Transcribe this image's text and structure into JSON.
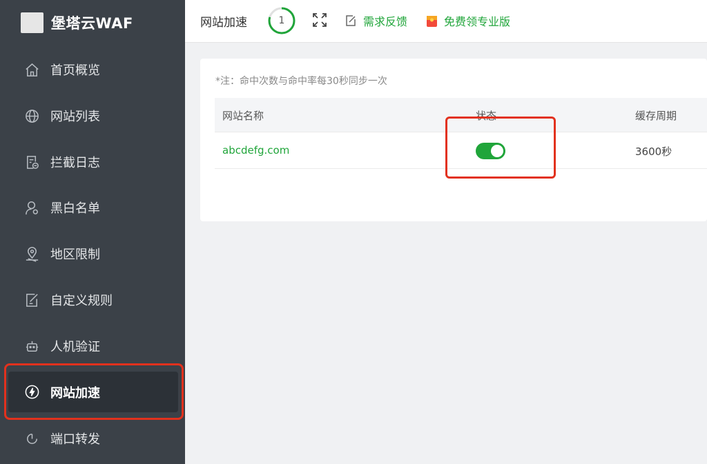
{
  "brand": {
    "name": "堡塔云WAF"
  },
  "sidebar": {
    "items": [
      {
        "label": "首页概览",
        "icon": "home-icon"
      },
      {
        "label": "网站列表",
        "icon": "globe-icon"
      },
      {
        "label": "拦截日志",
        "icon": "log-icon"
      },
      {
        "label": "黑白名单",
        "icon": "user-icon"
      },
      {
        "label": "地区限制",
        "icon": "location-pin-icon"
      },
      {
        "label": "自定义规则",
        "icon": "edit-rule-icon"
      },
      {
        "label": "人机验证",
        "icon": "robot-icon"
      },
      {
        "label": "网站加速",
        "icon": "lightning-icon",
        "active": true
      },
      {
        "label": "端口转发",
        "icon": "refresh-icon"
      }
    ]
  },
  "topbar": {
    "title": "网站加速",
    "progress_value": "1",
    "feedback_label": "需求反馈",
    "pro_label": "免费领专业版"
  },
  "main": {
    "note": "*注：命中次数与命中率每30秒同步一次",
    "table": {
      "columns": [
        "网站名称",
        "状态",
        "缓存周期"
      ],
      "rows": [
        {
          "site": "abcdefg.com",
          "status_on": true,
          "cache_period": "3600秒"
        }
      ]
    }
  },
  "colors": {
    "accent": "#20a53a",
    "sidebar_bg": "#3b4148",
    "highlight": "#e2311d"
  }
}
